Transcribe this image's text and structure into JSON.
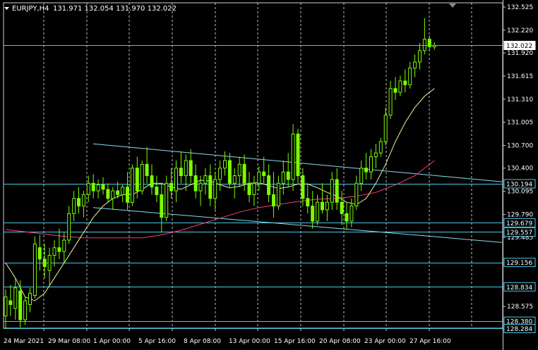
{
  "header": {
    "symbol": "EURJPY,H4",
    "ohlc": "131.971 132.054 131.970 132.022"
  },
  "colors": {
    "background": "#000000",
    "grid": "#ffffff",
    "candle": "#7cfc00",
    "fast_ma": "#f0f0a0",
    "slow_ma": "#ff3c78",
    "level_line": "#48c8e8",
    "trend_line": "#8adcec",
    "bid_line": "#8aa8c8",
    "axis_text": "#ffffff"
  },
  "price_axis": {
    "ticks": [
      "132.525",
      "132.220",
      "131.920",
      "131.615",
      "131.310",
      "131.005",
      "130.700",
      "130.400",
      "130.095",
      "129.790",
      "129.485",
      "128.575",
      "128.270"
    ],
    "range": [
      128.22,
      132.58
    ]
  },
  "current_price": "132.022",
  "level_lines": [
    "130.194",
    "129.679",
    "129.557",
    "129.156",
    "128.834",
    "128.380",
    "128.284"
  ],
  "time_axis": {
    "labels": [
      "24 Mar 2021",
      "29 Mar 08:00",
      "1 Apr 00:00",
      "5 Apr 16:00",
      "8 Apr 08:00",
      "13 Apr 00:00",
      "15 Apr 16:00",
      "20 Apr 08:00",
      "23 Apr 00:00",
      "27 Apr 16:00"
    ]
  },
  "trend_channel": {
    "upper": [
      [
        132,
        130.72
      ],
      [
        711,
        130.22
      ]
    ],
    "lower": [
      [
        132,
        129.88
      ],
      [
        711,
        129.42
      ]
    ]
  },
  "chart_data": {
    "type": "candlestick",
    "title": "EURJPY,H4",
    "ylim": [
      128.22,
      132.58
    ],
    "x_count": 183,
    "candles": [
      {
        "i": 0,
        "o": 128.45,
        "h": 128.8,
        "l": 128.28,
        "c": 128.7
      },
      {
        "i": 2,
        "o": 128.65,
        "h": 128.86,
        "l": 128.45,
        "c": 128.6
      },
      {
        "i": 4,
        "o": 128.55,
        "h": 128.95,
        "l": 128.4,
        "c": 128.82
      },
      {
        "i": 6,
        "o": 128.78,
        "h": 128.92,
        "l": 128.3,
        "c": 128.4
      },
      {
        "i": 8,
        "o": 128.4,
        "h": 128.7,
        "l": 128.33,
        "c": 128.65
      },
      {
        "i": 10,
        "o": 128.6,
        "h": 128.82,
        "l": 128.5,
        "c": 128.75
      },
      {
        "i": 12,
        "o": 128.72,
        "h": 129.5,
        "l": 128.68,
        "c": 129.4
      },
      {
        "i": 14,
        "o": 129.35,
        "h": 129.52,
        "l": 129.05,
        "c": 129.2
      },
      {
        "i": 16,
        "o": 129.2,
        "h": 129.4,
        "l": 128.95,
        "c": 129.1
      },
      {
        "i": 18,
        "o": 129.05,
        "h": 129.35,
        "l": 128.85,
        "c": 129.25
      },
      {
        "i": 20,
        "o": 129.25,
        "h": 129.45,
        "l": 129.1,
        "c": 129.35
      },
      {
        "i": 22,
        "o": 129.35,
        "h": 129.6,
        "l": 129.2,
        "c": 129.3
      },
      {
        "i": 24,
        "o": 129.3,
        "h": 129.55,
        "l": 129.15,
        "c": 129.45
      },
      {
        "i": 26,
        "o": 129.45,
        "h": 129.9,
        "l": 129.4,
        "c": 129.8
      },
      {
        "i": 28,
        "o": 129.8,
        "h": 130.1,
        "l": 129.7,
        "c": 130.0
      },
      {
        "i": 30,
        "o": 130.0,
        "h": 130.15,
        "l": 129.8,
        "c": 129.9
      },
      {
        "i": 32,
        "o": 129.9,
        "h": 130.1,
        "l": 129.75,
        "c": 130.05
      },
      {
        "i": 34,
        "o": 130.05,
        "h": 130.3,
        "l": 129.95,
        "c": 130.2
      },
      {
        "i": 36,
        "o": 130.2,
        "h": 130.32,
        "l": 130.0,
        "c": 130.1
      },
      {
        "i": 38,
        "o": 130.1,
        "h": 130.25,
        "l": 130.0,
        "c": 130.18
      },
      {
        "i": 40,
        "o": 130.18,
        "h": 130.28,
        "l": 130.05,
        "c": 130.12
      },
      {
        "i": 42,
        "o": 130.12,
        "h": 130.2,
        "l": 129.95,
        "c": 130.0
      },
      {
        "i": 44,
        "o": 130.0,
        "h": 130.15,
        "l": 129.85,
        "c": 130.1
      },
      {
        "i": 46,
        "o": 130.1,
        "h": 130.22,
        "l": 130.0,
        "c": 130.05
      },
      {
        "i": 48,
        "o": 130.05,
        "h": 130.18,
        "l": 129.95,
        "c": 130.15
      },
      {
        "i": 50,
        "o": 130.15,
        "h": 130.35,
        "l": 129.85,
        "c": 129.95
      },
      {
        "i": 52,
        "o": 129.95,
        "h": 130.45,
        "l": 129.9,
        "c": 130.4
      },
      {
        "i": 54,
        "o": 130.4,
        "h": 130.55,
        "l": 130.0,
        "c": 130.1
      },
      {
        "i": 56,
        "o": 130.1,
        "h": 130.5,
        "l": 130.05,
        "c": 130.45
      },
      {
        "i": 58,
        "o": 130.45,
        "h": 130.68,
        "l": 130.2,
        "c": 130.3
      },
      {
        "i": 60,
        "o": 130.3,
        "h": 130.45,
        "l": 130.05,
        "c": 130.15
      },
      {
        "i": 62,
        "o": 130.15,
        "h": 130.3,
        "l": 129.95,
        "c": 130.05
      },
      {
        "i": 64,
        "o": 130.05,
        "h": 130.2,
        "l": 129.55,
        "c": 129.75
      },
      {
        "i": 66,
        "o": 129.75,
        "h": 130.3,
        "l": 129.7,
        "c": 130.2
      },
      {
        "i": 68,
        "o": 130.2,
        "h": 130.4,
        "l": 130.0,
        "c": 130.1
      },
      {
        "i": 70,
        "o": 130.1,
        "h": 130.5,
        "l": 129.95,
        "c": 130.4
      },
      {
        "i": 72,
        "o": 130.4,
        "h": 130.62,
        "l": 130.2,
        "c": 130.3
      },
      {
        "i": 74,
        "o": 130.3,
        "h": 130.58,
        "l": 130.1,
        "c": 130.5
      },
      {
        "i": 76,
        "o": 130.5,
        "h": 130.65,
        "l": 130.2,
        "c": 130.3
      },
      {
        "i": 78,
        "o": 130.3,
        "h": 130.45,
        "l": 130.0,
        "c": 130.1
      },
      {
        "i": 80,
        "o": 130.1,
        "h": 130.3,
        "l": 129.9,
        "c": 130.2
      },
      {
        "i": 82,
        "o": 130.2,
        "h": 130.4,
        "l": 130.05,
        "c": 130.3
      },
      {
        "i": 84,
        "o": 130.3,
        "h": 130.45,
        "l": 129.9,
        "c": 130.0
      },
      {
        "i": 86,
        "o": 130.0,
        "h": 130.35,
        "l": 129.85,
        "c": 130.25
      },
      {
        "i": 88,
        "o": 130.25,
        "h": 130.5,
        "l": 130.1,
        "c": 130.4
      },
      {
        "i": 90,
        "o": 130.4,
        "h": 130.62,
        "l": 130.3,
        "c": 130.5
      },
      {
        "i": 92,
        "o": 130.5,
        "h": 130.6,
        "l": 130.15,
        "c": 130.2
      },
      {
        "i": 94,
        "o": 130.2,
        "h": 130.4,
        "l": 130.0,
        "c": 130.3
      },
      {
        "i": 96,
        "o": 130.3,
        "h": 130.55,
        "l": 130.15,
        "c": 130.45
      },
      {
        "i": 98,
        "o": 130.45,
        "h": 130.58,
        "l": 130.1,
        "c": 130.2
      },
      {
        "i": 100,
        "o": 130.2,
        "h": 130.35,
        "l": 129.95,
        "c": 130.05
      },
      {
        "i": 102,
        "o": 130.05,
        "h": 130.3,
        "l": 129.9,
        "c": 130.2
      },
      {
        "i": 104,
        "o": 130.2,
        "h": 130.42,
        "l": 130.1,
        "c": 130.35
      },
      {
        "i": 106,
        "o": 130.35,
        "h": 130.55,
        "l": 130.2,
        "c": 130.3
      },
      {
        "i": 108,
        "o": 130.3,
        "h": 130.45,
        "l": 129.95,
        "c": 130.05
      },
      {
        "i": 110,
        "o": 130.05,
        "h": 130.35,
        "l": 129.75,
        "c": 129.9
      },
      {
        "i": 112,
        "o": 129.9,
        "h": 130.3,
        "l": 129.85,
        "c": 130.2
      },
      {
        "i": 114,
        "o": 130.2,
        "h": 130.5,
        "l": 130.05,
        "c": 130.35
      },
      {
        "i": 116,
        "o": 130.35,
        "h": 130.6,
        "l": 130.15,
        "c": 130.25
      },
      {
        "i": 118,
        "o": 130.25,
        "h": 130.98,
        "l": 130.1,
        "c": 130.85
      },
      {
        "i": 120,
        "o": 130.85,
        "h": 130.92,
        "l": 130.2,
        "c": 130.3
      },
      {
        "i": 122,
        "o": 130.3,
        "h": 130.4,
        "l": 129.9,
        "c": 130.0
      },
      {
        "i": 124,
        "o": 130.0,
        "h": 130.2,
        "l": 129.8,
        "c": 129.9
      },
      {
        "i": 126,
        "o": 129.9,
        "h": 130.1,
        "l": 129.6,
        "c": 129.7
      },
      {
        "i": 128,
        "o": 129.7,
        "h": 130.05,
        "l": 129.65,
        "c": 129.95
      },
      {
        "i": 130,
        "o": 129.95,
        "h": 130.2,
        "l": 129.8,
        "c": 129.85
      },
      {
        "i": 132,
        "o": 129.85,
        "h": 130.05,
        "l": 129.7,
        "c": 129.95
      },
      {
        "i": 134,
        "o": 129.95,
        "h": 130.35,
        "l": 129.85,
        "c": 130.25
      },
      {
        "i": 136,
        "o": 130.25,
        "h": 130.4,
        "l": 129.85,
        "c": 129.95
      },
      {
        "i": 138,
        "o": 129.95,
        "h": 130.1,
        "l": 129.65,
        "c": 129.8
      },
      {
        "i": 140,
        "o": 129.8,
        "h": 129.95,
        "l": 129.6,
        "c": 129.7
      },
      {
        "i": 142,
        "o": 129.7,
        "h": 130.0,
        "l": 129.62,
        "c": 129.9
      },
      {
        "i": 144,
        "o": 129.9,
        "h": 130.3,
        "l": 129.85,
        "c": 130.2
      },
      {
        "i": 146,
        "o": 130.2,
        "h": 130.5,
        "l": 130.1,
        "c": 130.4
      },
      {
        "i": 148,
        "o": 130.4,
        "h": 130.6,
        "l": 130.25,
        "c": 130.35
      },
      {
        "i": 150,
        "o": 130.35,
        "h": 130.65,
        "l": 130.25,
        "c": 130.55
      },
      {
        "i": 152,
        "o": 130.55,
        "h": 130.72,
        "l": 130.4,
        "c": 130.6
      },
      {
        "i": 154,
        "o": 130.6,
        "h": 130.8,
        "l": 130.55,
        "c": 130.75
      },
      {
        "i": 156,
        "o": 130.75,
        "h": 131.2,
        "l": 130.7,
        "c": 131.1
      },
      {
        "i": 158,
        "o": 131.1,
        "h": 131.55,
        "l": 131.05,
        "c": 131.45
      },
      {
        "i": 160,
        "o": 131.45,
        "h": 131.6,
        "l": 131.3,
        "c": 131.4
      },
      {
        "i": 162,
        "o": 131.4,
        "h": 131.62,
        "l": 131.35,
        "c": 131.55
      },
      {
        "i": 164,
        "o": 131.55,
        "h": 131.7,
        "l": 131.4,
        "c": 131.5
      },
      {
        "i": 166,
        "o": 131.5,
        "h": 131.8,
        "l": 131.45,
        "c": 131.72
      },
      {
        "i": 168,
        "o": 131.72,
        "h": 131.9,
        "l": 131.6,
        "c": 131.8
      },
      {
        "i": 170,
        "o": 131.8,
        "h": 132.05,
        "l": 131.7,
        "c": 131.95
      },
      {
        "i": 172,
        "o": 131.95,
        "h": 132.38,
        "l": 131.9,
        "c": 132.1
      },
      {
        "i": 174,
        "o": 132.1,
        "h": 132.15,
        "l": 131.95,
        "c": 132.0
      },
      {
        "i": 176,
        "o": 132.0,
        "h": 132.06,
        "l": 131.96,
        "c": 132.02
      }
    ],
    "fast_ma": [
      [
        0,
        129.15
      ],
      [
        4,
        128.95
      ],
      [
        8,
        128.7
      ],
      [
        12,
        128.65
      ],
      [
        16,
        128.75
      ],
      [
        20,
        128.95
      ],
      [
        24,
        129.15
      ],
      [
        28,
        129.35
      ],
      [
        32,
        129.55
      ],
      [
        36,
        129.75
      ],
      [
        40,
        129.9
      ],
      [
        44,
        130.0
      ],
      [
        48,
        130.05
      ],
      [
        52,
        130.05
      ],
      [
        56,
        130.12
      ],
      [
        60,
        130.2
      ],
      [
        64,
        130.2
      ],
      [
        68,
        130.15
      ],
      [
        72,
        130.12
      ],
      [
        76,
        130.18
      ],
      [
        80,
        130.24
      ],
      [
        84,
        130.23
      ],
      [
        88,
        130.18
      ],
      [
        92,
        130.14
      ],
      [
        96,
        130.16
      ],
      [
        100,
        130.2
      ],
      [
        104,
        130.21
      ],
      [
        108,
        130.17
      ],
      [
        112,
        130.13
      ],
      [
        116,
        130.15
      ],
      [
        120,
        130.19
      ],
      [
        124,
        130.19
      ],
      [
        128,
        130.14
      ],
      [
        132,
        130.08
      ],
      [
        136,
        130.03
      ],
      [
        140,
        129.95
      ],
      [
        144,
        129.92
      ],
      [
        148,
        130.0
      ],
      [
        152,
        130.2
      ],
      [
        156,
        130.45
      ],
      [
        160,
        130.75
      ],
      [
        164,
        131.0
      ],
      [
        168,
        131.2
      ],
      [
        172,
        131.35
      ],
      [
        176,
        131.45
      ]
    ],
    "slow_ma": [
      [
        0,
        129.59
      ],
      [
        8,
        129.56
      ],
      [
        16,
        129.53
      ],
      [
        24,
        129.5
      ],
      [
        32,
        129.48
      ],
      [
        40,
        129.48
      ],
      [
        48,
        129.48
      ],
      [
        56,
        129.48
      ],
      [
        64,
        129.52
      ],
      [
        72,
        129.58
      ],
      [
        80,
        129.66
      ],
      [
        88,
        129.74
      ],
      [
        96,
        129.82
      ],
      [
        104,
        129.88
      ],
      [
        112,
        129.92
      ],
      [
        120,
        129.96
      ],
      [
        128,
        129.99
      ],
      [
        136,
        130.0
      ],
      [
        144,
        130.03
      ],
      [
        152,
        130.08
      ],
      [
        160,
        130.18
      ],
      [
        168,
        130.3
      ],
      [
        176,
        130.5
      ]
    ]
  }
}
